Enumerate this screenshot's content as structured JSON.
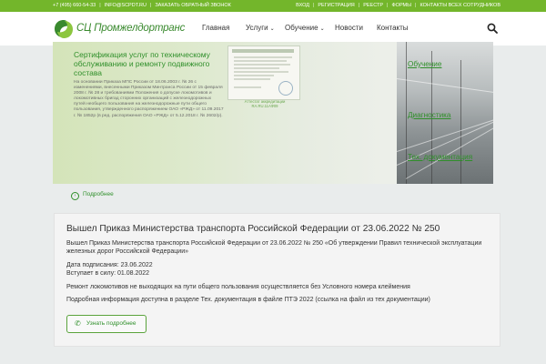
{
  "topbar": {
    "phone": "+7 (495) 660-54-33",
    "email": "INFO@SCPDT.RU",
    "callback": "ЗАКАЗАТЬ ОБРАТНЫЙ ЗВОНОК",
    "links": [
      "ВХОД",
      "РЕГИСТРАЦИЯ",
      "РЕЕСТР",
      "ФОРМЫ",
      "КОНТАКТЫ ВСЕХ СОТРУДНИКОВ"
    ]
  },
  "brand": {
    "name": "СЦ Промжелдортранс",
    "colors": {
      "primary": "#73b62b",
      "dark_green": "#2f8f2a"
    }
  },
  "nav": {
    "items": [
      {
        "label": "Главная",
        "dropdown": false
      },
      {
        "label": "Услуги",
        "dropdown": true
      },
      {
        "label": "Обучение",
        "dropdown": true
      },
      {
        "label": "Новости",
        "dropdown": false
      },
      {
        "label": "Контакты",
        "dropdown": false
      }
    ],
    "search_icon": "search-icon"
  },
  "banner": {
    "title": "Сертификация услуг по техническому обслуживанию и ремонту подвижного состава",
    "text": "На основании Приказа МПС России от 18.06.2003 г. № 26 с изменениями, внесенными Приказом Минтранса России от 15 февраля 2008 г. № 28 и требованиями Положения о допуске локомотивов и локомотивных бригад сторонних организаций с железнодорожных путей необщего пользования на железнодорожные пути общего пользования, утвержденного распоряжением ОАО «РЖД» от 11.09.2017 г. № 1852р (в ред. распоряжения ОАО «РЖД» от 5.12.2018 г. № 2602/р).",
    "cert_caption_line1": "Аттестат аккредитации",
    "cert_caption_line2": "RA.RU.11АФ09",
    "side_links": [
      "Обучение",
      "Диагностика",
      "Тех. документация"
    ],
    "more": "Подробнее"
  },
  "news": {
    "title": "Вышел Приказ Министерства транспорта Российской Федерации от 23.06.2022 № 250",
    "body1": "Вышел Приказ Министерства транспорта Российской Федерации от 23.06.2022 № 250 «Об утверждении Правил технической эксплуатации железных дорог Российской Федерации»",
    "signed": "Дата подписания: 23.06.2022",
    "effective": "Вступает в силу: 01.08.2022",
    "body2": "Ремонт локомотивов не выходящих на пути общего пользования осуществляется без Условного номера клеймения",
    "body3": "Подробная информация доступна в разделе Тех. документация в файле ПТЭ 2022 (ссылка на файл из тех документации)",
    "button": "Узнать подробнее"
  }
}
